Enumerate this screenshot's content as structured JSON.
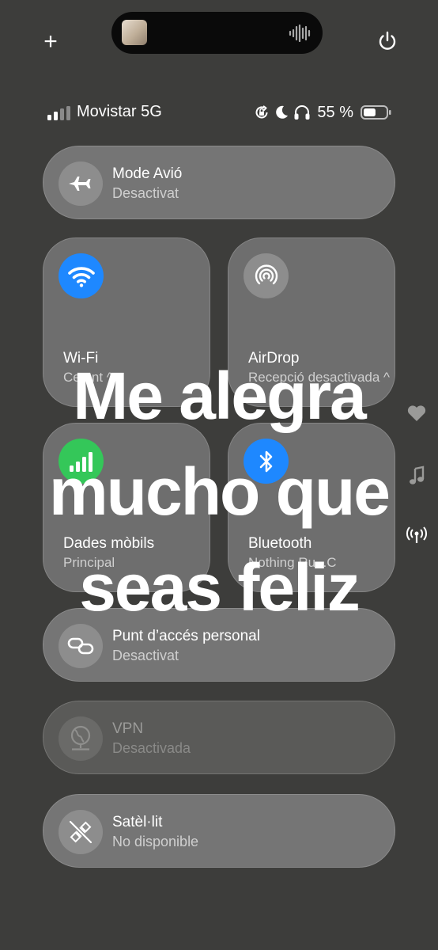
{
  "top": {
    "plus_label": "+",
    "now_playing": {
      "art_icon": "album-art",
      "wave_icon": "audio-waveform-icon"
    },
    "power_icon": "power-icon"
  },
  "status": {
    "carrier": "Movistar 5G",
    "battery_percent": "55 %",
    "battery_level": 0.55,
    "icons": [
      "signal-bars-icon",
      "orientation-lock-icon",
      "moon-icon",
      "headphones-icon",
      "battery-icon"
    ]
  },
  "airplane": {
    "title": "Mode Avió",
    "subtitle": "Desactivat"
  },
  "wifi": {
    "title": "Wi-Fi",
    "subtitle": "Ce...nt ^",
    "color": "#1e88ff"
  },
  "airdrop": {
    "title": "AirDrop",
    "subtitle": "Recepció desactivada ^"
  },
  "cellular": {
    "title": "Dades mòbils",
    "subtitle": "Principal",
    "color": "#34c759"
  },
  "bluetooth": {
    "title": "Bluetooth",
    "subtitle": "Nothing Ru...C",
    "color": "#1e88ff"
  },
  "hotspot": {
    "title": "Punt d’accés personal",
    "subtitle": "Desactivat"
  },
  "vpn": {
    "title": "VPN",
    "subtitle": "Desactivada"
  },
  "satellite": {
    "title": "Satèl·lit",
    "subtitle": "No disponible"
  },
  "caption": {
    "text": "Me alegra\nmucho que\nseas feliz"
  },
  "side_icons": [
    "heart-icon",
    "music-note-icon",
    "broadcast-icon"
  ]
}
